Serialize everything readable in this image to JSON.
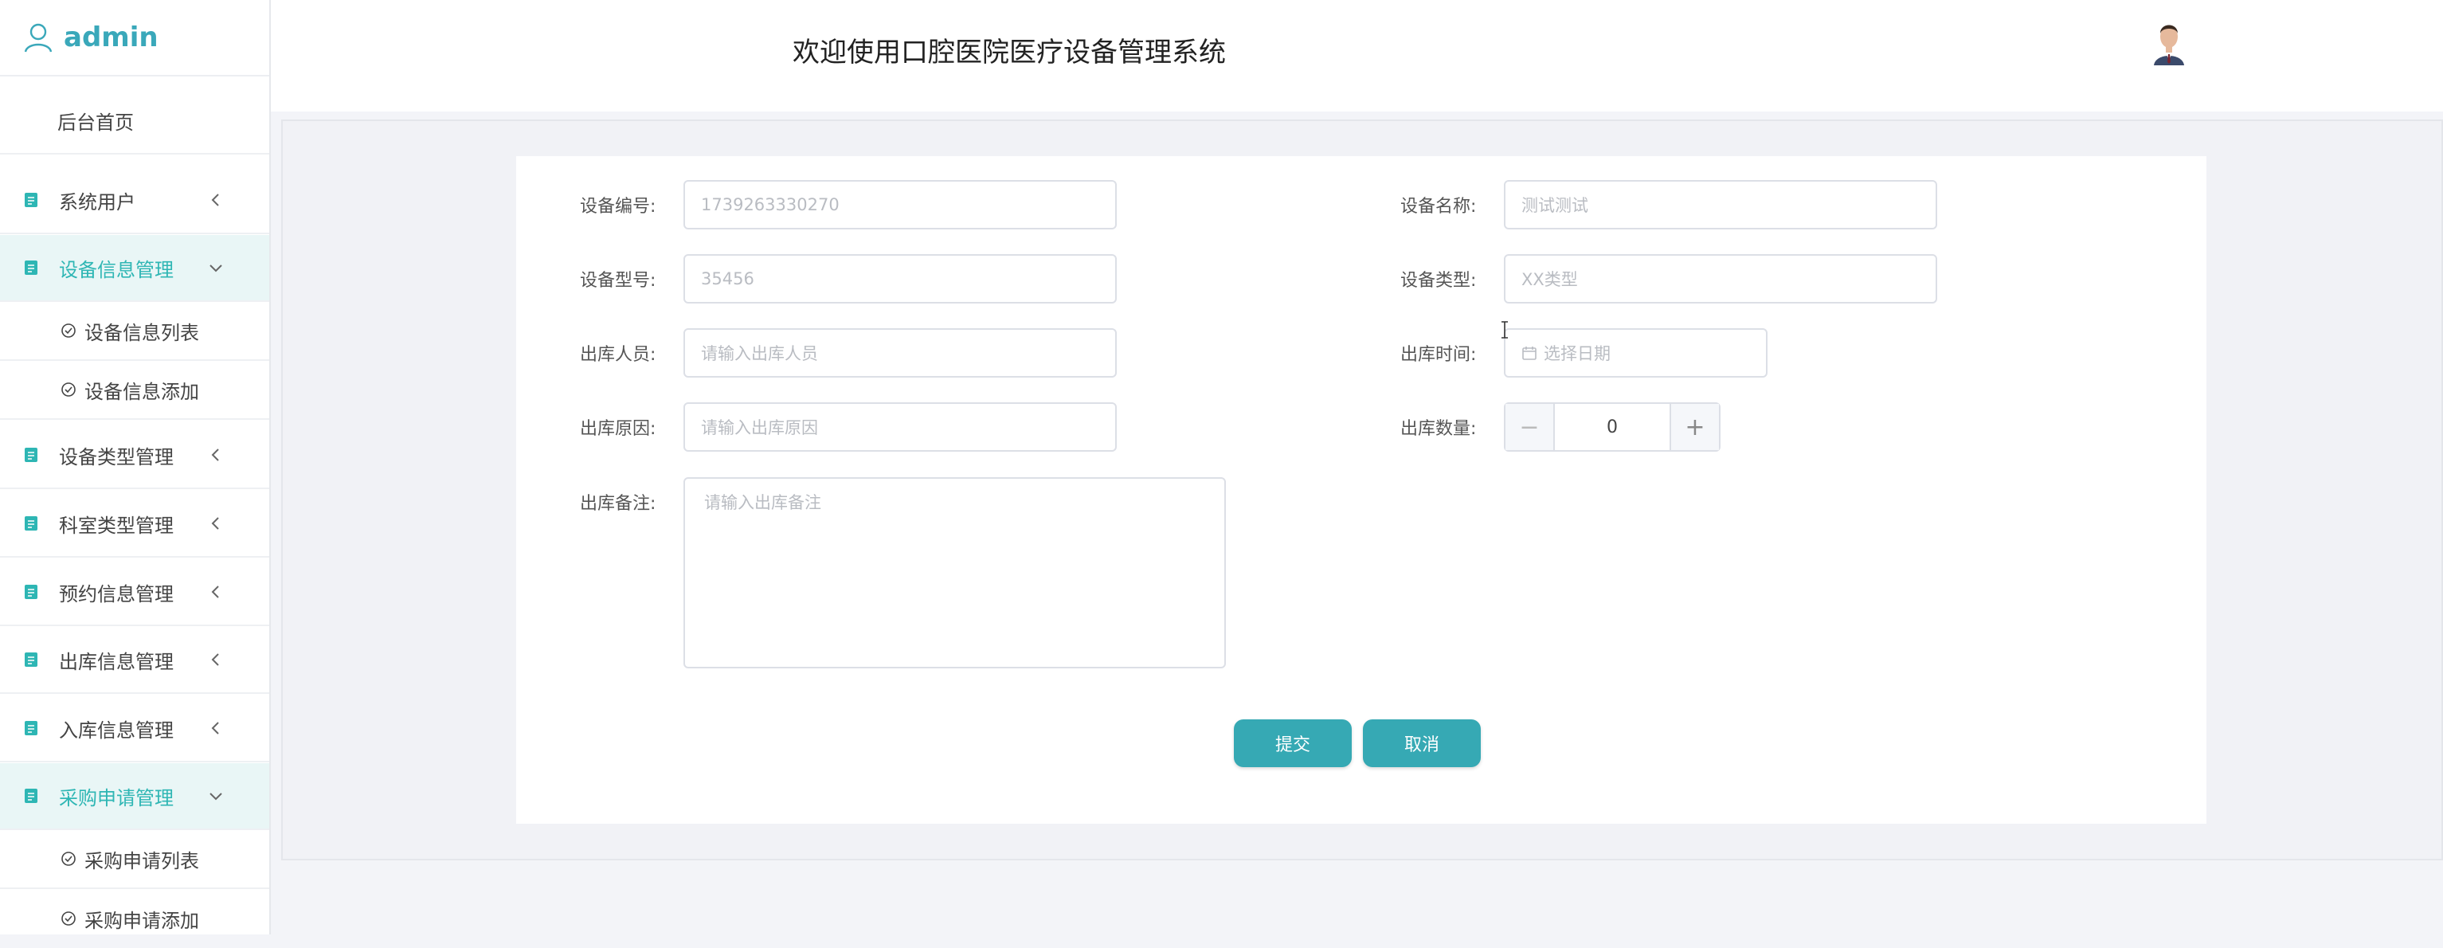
{
  "sidebar": {
    "user": "admin",
    "home": "后台首页",
    "menus": [
      {
        "label": "系统用户"
      },
      {
        "label": "设备信息管理",
        "subs": [
          "设备信息列表",
          "设备信息添加"
        ]
      },
      {
        "label": "设备类型管理"
      },
      {
        "label": "科室类型管理"
      },
      {
        "label": "预约信息管理"
      },
      {
        "label": "出库信息管理"
      },
      {
        "label": "入库信息管理"
      },
      {
        "label": "采购申请管理",
        "subs": [
          "采购申请列表",
          "采购申请添加"
        ]
      }
    ]
  },
  "header": {
    "title": "欢迎使用口腔医院医疗设备管理系统"
  },
  "form": {
    "device_no": {
      "label": "设备编号:",
      "placeholder": "1739263330270"
    },
    "device_name": {
      "label": "设备名称:",
      "placeholder": "测试测试"
    },
    "device_model": {
      "label": "设备型号:",
      "placeholder": "35456"
    },
    "device_type": {
      "label": "设备类型:",
      "placeholder": "XX类型"
    },
    "out_person": {
      "label": "出库人员:",
      "placeholder": "请输入出库人员"
    },
    "out_time": {
      "label": "出库时间:",
      "placeholder": "选择日期"
    },
    "out_reason": {
      "label": "出库原因:",
      "placeholder": "请输入出库原因"
    },
    "out_qty": {
      "label": "出库数量:",
      "value": "0",
      "minus": "−",
      "plus": "+"
    },
    "out_note": {
      "label": "出库备注:",
      "placeholder": "请输入出库备注"
    },
    "submit": "提交",
    "cancel": "取消"
  },
  "colors": {
    "accent": "#36a9b4",
    "active_bg": "#e9f6f6",
    "active_text": "#2eb6b4"
  }
}
